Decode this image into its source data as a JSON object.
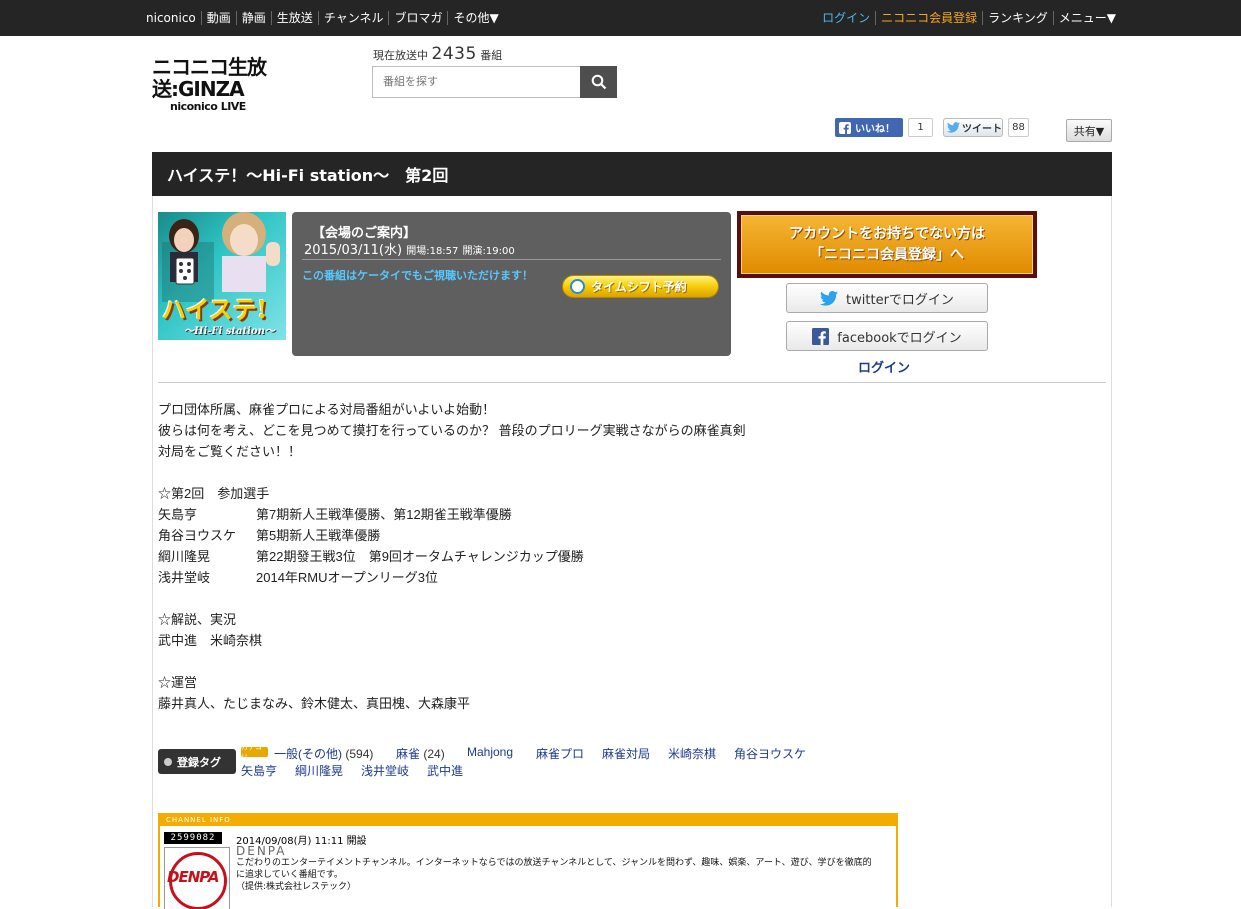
{
  "nav": {
    "left": [
      "niconico",
      "動画",
      "静画",
      "生放送",
      "チャンネル",
      "ブロマガ",
      "その他▼"
    ],
    "login": "ログイン",
    "signup": "ニコニコ会員登録",
    "ranking": "ランキング",
    "menu": "メニュー▼"
  },
  "header": {
    "logo_main": "ニコニコ生放送:GINZA",
    "logo_sub": "niconico LIVE",
    "onair_prefix": "現在放送中",
    "onair_count": "2435",
    "onair_suffix": "番組",
    "search_placeholder": "番組を探す"
  },
  "social": {
    "fb_like": "いいね！",
    "fb_count": "1",
    "tweet": "ツイート",
    "tweet_count": "88",
    "share": "共有▼"
  },
  "program": {
    "title": "ハイステ！〜Hi-Fi station〜　第2回",
    "thumb_title": "ハイステ!",
    "thumb_sub": "〜Hi-Fi station〜",
    "venue_head": "【会場のご案内】",
    "date": "2015/03/11(水)",
    "open": "開場:18:57",
    "start": "開演:19:00",
    "mobile_note": "この番組はケータイでもご視聴いただけます！",
    "timeshift": "タイムシフト予約"
  },
  "account": {
    "signup_line1": "アカウントをお持ちでない方は",
    "signup_line2": "「ニコニコ会員登録」へ",
    "twitter_login": "twitterでログイン",
    "facebook_login": "facebookでログイン",
    "login": "ログイン"
  },
  "description": {
    "intro": [
      "プロ団体所属、麻雀プロによる対局番組がいよいよ始動！",
      "彼らは何を考え、どこを見つめて摸打を行っているのか？ 普段のプロリーグ実戦さながらの麻雀真剣",
      "対局をご覧ください！！"
    ],
    "players_head": "☆第2回　参加選手",
    "players": [
      {
        "name": "矢島亨",
        "record": "第7期新人王戦準優勝、第12期雀王戦準優勝"
      },
      {
        "name": "角谷ヨウスケ",
        "record": "第5期新人王戦準優勝"
      },
      {
        "name": "綱川隆晃",
        "record": "第22期發王戦3位　第9回オータムチャレンジカップ優勝"
      },
      {
        "name": "浅井堂岐",
        "record": "2014年RMUオープンリーグ3位"
      }
    ],
    "commentary_head": "☆解説、実況",
    "commentary": "武中進　米崎奈棋",
    "staff_head": "☆運営",
    "staff": "藤井真人、たじまなみ、鈴木健太、真田槐、大森康平"
  },
  "tags": {
    "label": "登録タグ",
    "category_badge": "カテゴリ",
    "row1": [
      {
        "text": "一般(その他)",
        "count": "(594)"
      },
      {
        "text": "麻雀",
        "count": "(24)"
      },
      {
        "text": "Mahjong",
        "count": ""
      },
      {
        "text": "麻雀プロ",
        "count": ""
      },
      {
        "text": "麻雀対局",
        "count": ""
      },
      {
        "text": "米崎奈棋",
        "count": ""
      },
      {
        "text": "角谷ヨウスケ",
        "count": ""
      }
    ],
    "row2": [
      "矢島亨",
      "綱川隆晃",
      "浅井堂岐",
      "武中進"
    ]
  },
  "channel": {
    "header": "CHANNEL INFO",
    "counter": "2599082",
    "logo_text": "DENPA",
    "date": "2014/09/08(月) 11:11 開設",
    "name": "DENPA",
    "desc": "こだわりのエンターテイメントチャンネル。インターネットならではの放送チャンネルとして、ジャンルを問わず、趣味、娯楽、アート、遊び、学びを徹底的に追求していく番組です。",
    "provider": "（提供:株式会社レステック）"
  }
}
